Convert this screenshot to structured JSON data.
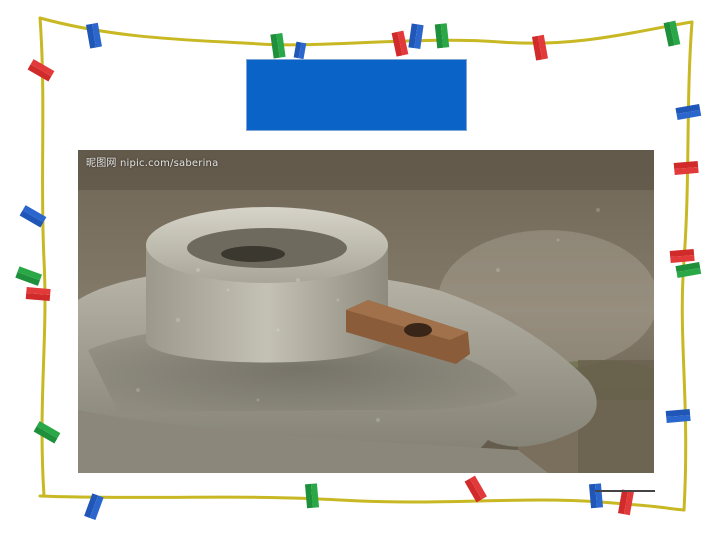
{
  "slide": {
    "background": "#ffffff",
    "frame_color": "#c8b823",
    "title_box": {
      "text": "",
      "fill": "#0a64c8",
      "border": "#7fa6d6"
    }
  },
  "photo": {
    "watermark": "昵图网 nipic.com/saberina",
    "subject": "stone-mill"
  },
  "clothespins": [
    {
      "color": "#1f56b8"
    },
    {
      "color": "#1e8f3a"
    },
    {
      "color": "#d02a2a"
    },
    {
      "color": "#1f56b8"
    }
  ]
}
